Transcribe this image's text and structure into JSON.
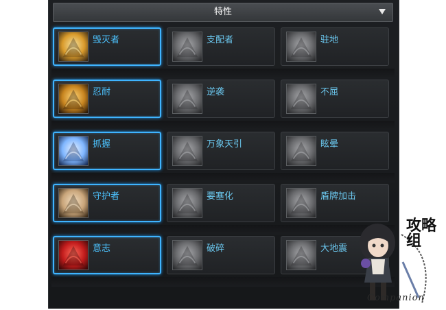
{
  "panel": {
    "title": "特性"
  },
  "rows": [
    {
      "cards": [
        {
          "label": "毁灭者",
          "selected": true,
          "icon": "destroyer-icon"
        },
        {
          "label": "支配者",
          "selected": false,
          "icon": "dominator-icon"
        },
        {
          "label": "驻地",
          "selected": false,
          "icon": "garrison-icon"
        }
      ]
    },
    {
      "cards": [
        {
          "label": "忍耐",
          "selected": true,
          "icon": "endurance-icon"
        },
        {
          "label": "逆袭",
          "selected": false,
          "icon": "counterattack-icon"
        },
        {
          "label": "不屈",
          "selected": false,
          "icon": "unyielding-icon"
        }
      ]
    },
    {
      "cards": [
        {
          "label": "抓握",
          "selected": true,
          "icon": "grasp-icon"
        },
        {
          "label": "万象天引",
          "selected": false,
          "icon": "universal-pull-icon"
        },
        {
          "label": "眩晕",
          "selected": false,
          "icon": "stun-icon"
        }
      ]
    },
    {
      "cards": [
        {
          "label": "守护者",
          "selected": true,
          "icon": "guardian-icon"
        },
        {
          "label": "要塞化",
          "selected": false,
          "icon": "fortify-icon"
        },
        {
          "label": "盾牌加击",
          "selected": false,
          "icon": "shield-bash-icon"
        }
      ]
    },
    {
      "cards": [
        {
          "label": "意志",
          "selected": true,
          "icon": "will-icon"
        },
        {
          "label": "破碎",
          "selected": false,
          "icon": "shatter-icon"
        },
        {
          "label": "大地震",
          "selected": false,
          "icon": "earthquake-icon"
        }
      ]
    }
  ],
  "watermark": {
    "text": "Companion",
    "chars": "攻略组",
    "badge": "CBN"
  },
  "colors": {
    "selected_border": "#3fb4ff",
    "label": "#4cc3ff",
    "panel_bg": "#1d1f22"
  }
}
